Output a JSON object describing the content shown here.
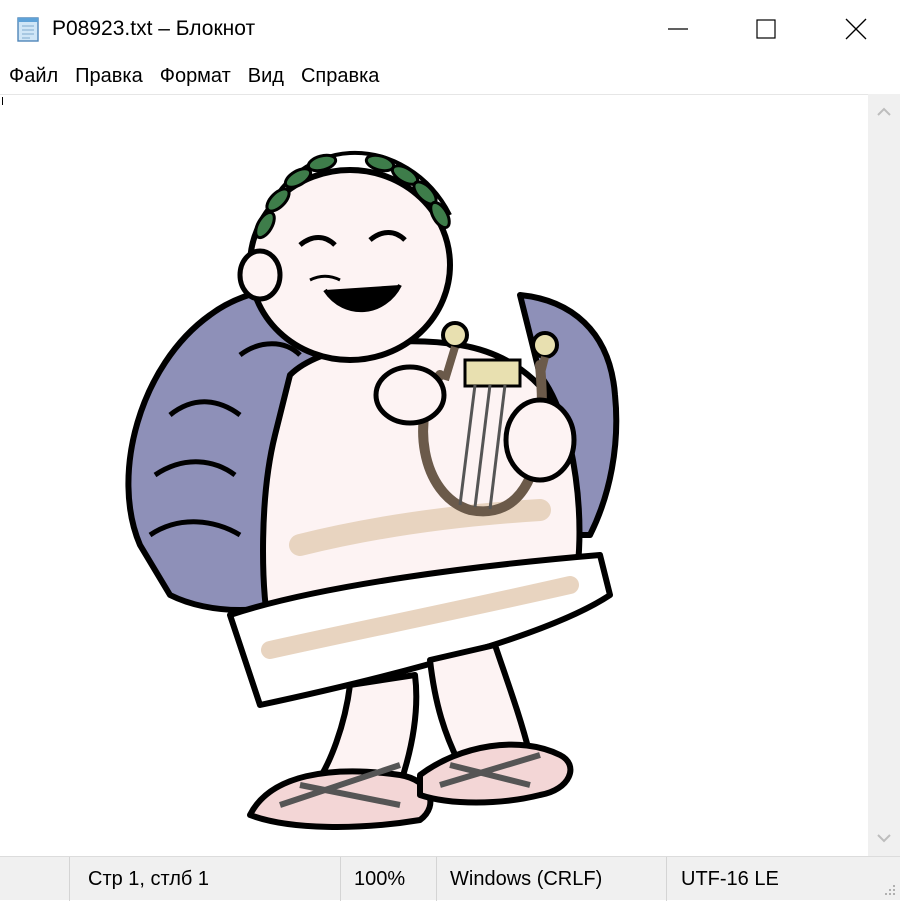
{
  "window": {
    "title": "P08923.txt – Блокнот",
    "icon": "notepad-icon",
    "controls": [
      "minimize-icon",
      "maximize-icon",
      "close-icon"
    ]
  },
  "menu": {
    "items": [
      {
        "label": "Файл"
      },
      {
        "label": "Правка"
      },
      {
        "label": "Формат"
      },
      {
        "label": "Вид"
      },
      {
        "label": "Справка"
      }
    ]
  },
  "editor": {
    "content_image": "roman-emperor-lyre-cartoon"
  },
  "scrollbar": {
    "up_icon": "chevron-up-icon",
    "down_icon": "chevron-down-icon"
  },
  "status": {
    "position": "Стр 1, стлб 1",
    "zoom": "100%",
    "line_ending": "Windows (CRLF)",
    "encoding": "UTF-16 LE"
  },
  "colors": {
    "cloak": "#8e90b8",
    "skin": "#f9e6e6",
    "laurel": "#3e7d4a",
    "tunic_shade": "#e8d4c0",
    "lyre": "#6b5a4a"
  }
}
